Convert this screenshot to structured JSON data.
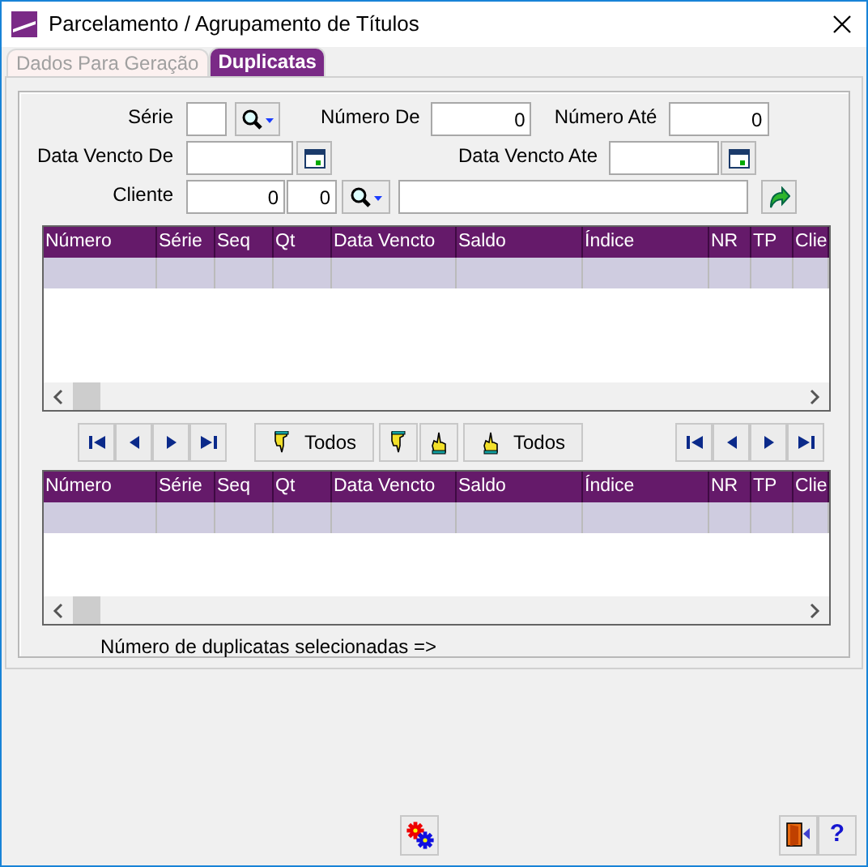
{
  "window": {
    "title": "Parcelamento / Agrupamento de Títulos"
  },
  "tabs": [
    {
      "label": "Dados Para Geração",
      "selected": false
    },
    {
      "label": "Duplicatas",
      "selected": true
    }
  ],
  "filters": {
    "serie": {
      "label": "Série"
    },
    "numero_de": {
      "label": "Número De",
      "value": "0"
    },
    "numero_ate": {
      "label": "Número Até",
      "value": "0"
    },
    "data_vencto_de": {
      "label": "Data Vencto De"
    },
    "data_vencto_ate": {
      "label": "Data Vencto Ate"
    },
    "cliente": {
      "label": "Cliente",
      "code": "0",
      "branch": "0"
    }
  },
  "grids": [
    {
      "columns": [
        "Número",
        "Série",
        "Seq",
        "Qt",
        "Data Vencto",
        "Saldo",
        "Índice",
        "NR",
        "TP",
        "Clie"
      ],
      "rows": [
        {
          "selected": true
        }
      ]
    },
    {
      "columns": [
        "Número",
        "Série",
        "Seq",
        "Qt",
        "Data Vencto",
        "Saldo",
        "Índice",
        "NR",
        "TP",
        "Clie"
      ],
      "rows": [
        {
          "selected": true
        }
      ]
    }
  ],
  "selection_buttons": [
    {
      "kind": "mark-all",
      "label": "Todos"
    },
    {
      "kind": "mark"
    },
    {
      "kind": "unmark"
    },
    {
      "kind": "unmark-all",
      "label": "Todos"
    }
  ],
  "status_text": "Número de duplicatas selecionadas =>",
  "help_button": "?"
}
